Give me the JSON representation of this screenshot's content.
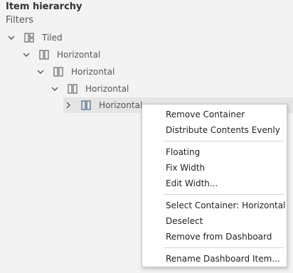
{
  "panel": {
    "title": "Item hierarchy",
    "subtitle": "Filters"
  },
  "tree": {
    "items": [
      {
        "label": "Tiled",
        "icon": "tiled-layout-icon",
        "expanded": true
      },
      {
        "label": "Horizontal",
        "icon": "horizontal-container-icon",
        "expanded": true
      },
      {
        "label": "Horizontal",
        "icon": "horizontal-container-icon",
        "expanded": true
      },
      {
        "label": "Horizontal",
        "icon": "horizontal-container-icon",
        "expanded": true
      },
      {
        "label": "Horizontal",
        "icon": "horizontal-container-icon",
        "expanded": false,
        "selected": true
      }
    ]
  },
  "context_menu": {
    "items": [
      {
        "label": "Remove Container"
      },
      {
        "label": "Distribute Contents Evenly"
      },
      {
        "label": "Floating"
      },
      {
        "label": "Fix Width"
      },
      {
        "label": "Edit Width..."
      },
      {
        "label": "Select Container: Horizontal"
      },
      {
        "label": "Deselect"
      },
      {
        "label": "Remove from Dashboard"
      },
      {
        "label": "Rename Dashboard Item..."
      }
    ]
  },
  "colors": {
    "background": "#f3f3f3",
    "selected_row": "#e5e5e5",
    "icon_stroke": "#666666",
    "selected_icon_stroke": "#4f6f8f",
    "menu_background": "#ffffff",
    "menu_border": "#c8c8c8"
  }
}
